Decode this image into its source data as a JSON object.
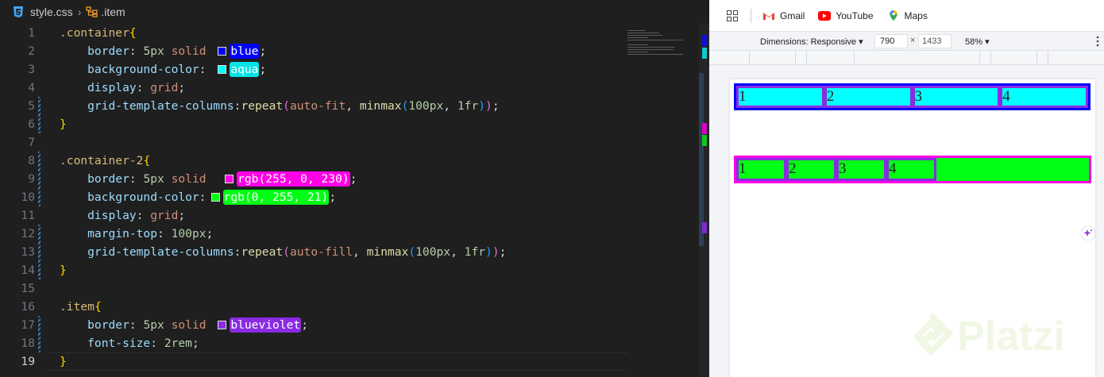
{
  "editor": {
    "breadcrumb": {
      "file": "style.css",
      "symbol": ".item"
    },
    "active_line": 19,
    "lines": [
      {
        "n": "1",
        "parts": [
          [
            "sel",
            ".container"
          ],
          [
            "br",
            "{"
          ]
        ]
      },
      {
        "n": "2",
        "parts": [
          [
            "prop",
            "    border"
          ],
          [
            "pn",
            ": "
          ],
          [
            "num",
            "5px"
          ],
          [
            "val",
            " solid "
          ],
          [
            "sw:#0000ff",
            ""
          ],
          [
            "hl:#0000ff",
            "blue"
          ],
          [
            "pn",
            ";"
          ]
        ]
      },
      {
        "n": "3",
        "parts": [
          [
            "prop",
            "    background-color"
          ],
          [
            "pn",
            ": "
          ],
          [
            "sw:#00ffff",
            ""
          ],
          [
            "hl:#00e5e5",
            "aqua"
          ],
          [
            "pn",
            ";"
          ]
        ]
      },
      {
        "n": "4",
        "parts": [
          [
            "prop",
            "    display"
          ],
          [
            "pn",
            ": "
          ],
          [
            "val",
            "grid"
          ],
          [
            "pn",
            ";"
          ]
        ]
      },
      {
        "n": "5",
        "parts": [
          [
            "prop",
            "    grid-template-columns"
          ],
          [
            "pn",
            ":"
          ],
          [
            "fn",
            "repeat"
          ],
          [
            "br2",
            "("
          ],
          [
            "val",
            "auto-fit"
          ],
          [
            "pn",
            ", "
          ],
          [
            "fn",
            "minmax"
          ],
          [
            "br3",
            "("
          ],
          [
            "num",
            "100px"
          ],
          [
            "pn",
            ", "
          ],
          [
            "num",
            "1fr"
          ],
          [
            "br3",
            ")"
          ],
          [
            "br2",
            ")"
          ],
          [
            "pn",
            ";"
          ]
        ]
      },
      {
        "n": "6",
        "parts": [
          [
            "br",
            "}"
          ]
        ]
      },
      {
        "n": "7",
        "parts": []
      },
      {
        "n": "8",
        "parts": [
          [
            "sel",
            ".container-2"
          ],
          [
            "br",
            "{"
          ]
        ]
      },
      {
        "n": "9",
        "parts": [
          [
            "prop",
            "    border"
          ],
          [
            "pn",
            ": "
          ],
          [
            "num",
            "5px"
          ],
          [
            "val",
            " solid  "
          ],
          [
            "sw:#ff00e6",
            ""
          ],
          [
            "hl:#ff00e6",
            "rgb(255, 0, 230)"
          ],
          [
            "pn",
            ";"
          ]
        ]
      },
      {
        "n": "10",
        "parts": [
          [
            "prop",
            "    background-color"
          ],
          [
            "pn",
            ":"
          ],
          [
            "sw:#00ff15",
            ""
          ],
          [
            "hl:#00ff15",
            "rgb(0, 255, 21)"
          ],
          [
            "pn",
            ";"
          ]
        ]
      },
      {
        "n": "11",
        "parts": [
          [
            "prop",
            "    display"
          ],
          [
            "pn",
            ": "
          ],
          [
            "val",
            "grid"
          ],
          [
            "pn",
            ";"
          ]
        ]
      },
      {
        "n": "12",
        "parts": [
          [
            "prop",
            "    margin-top"
          ],
          [
            "pn",
            ": "
          ],
          [
            "num",
            "100px"
          ],
          [
            "pn",
            ";"
          ]
        ]
      },
      {
        "n": "13",
        "parts": [
          [
            "prop",
            "    grid-template-columns"
          ],
          [
            "pn",
            ":"
          ],
          [
            "fn",
            "repeat"
          ],
          [
            "br2",
            "("
          ],
          [
            "val",
            "auto-fill"
          ],
          [
            "pn",
            ", "
          ],
          [
            "fn",
            "minmax"
          ],
          [
            "br3",
            "("
          ],
          [
            "num",
            "100px"
          ],
          [
            "pn",
            ", "
          ],
          [
            "num",
            "1fr"
          ],
          [
            "br3",
            ")"
          ],
          [
            "br2",
            ")"
          ],
          [
            "pn",
            ";"
          ]
        ]
      },
      {
        "n": "14",
        "parts": [
          [
            "br",
            "}"
          ]
        ]
      },
      {
        "n": "15",
        "parts": []
      },
      {
        "n": "16",
        "parts": [
          [
            "sel",
            ".item"
          ],
          [
            "br",
            "{"
          ]
        ]
      },
      {
        "n": "17",
        "parts": [
          [
            "prop",
            "    border"
          ],
          [
            "pn",
            ": "
          ],
          [
            "num",
            "5px"
          ],
          [
            "val",
            " solid "
          ],
          [
            "sw:#8a2be2",
            ""
          ],
          [
            "hl:#8a2be2",
            "blueviolet"
          ],
          [
            "pn",
            ";"
          ]
        ]
      },
      {
        "n": "18",
        "parts": [
          [
            "prop",
            "    font-size"
          ],
          [
            "pn",
            ": "
          ],
          [
            "num",
            "2rem"
          ],
          [
            "pn",
            ";"
          ]
        ]
      },
      {
        "n": "19",
        "parts": [
          [
            "br",
            "}"
          ]
        ]
      }
    ]
  },
  "browser": {
    "bookmarks": [
      {
        "label": "Gmail",
        "icon": "gmail-icon",
        "color": "#ea4335"
      },
      {
        "label": "YouTube",
        "icon": "youtube-icon",
        "color": "#ff0000"
      },
      {
        "label": "Maps",
        "icon": "maps-icon",
        "color": "#34a853"
      }
    ],
    "devtools": {
      "dimensions_label": "Dimensions: Responsive ▾",
      "width": "790",
      "x": "×",
      "height": "1433",
      "zoom": "58% ▾"
    },
    "page": {
      "container_items": [
        "1",
        "2",
        "3",
        "4"
      ],
      "container2_items": [
        "1",
        "2",
        "3",
        "4"
      ]
    }
  },
  "watermark": "Platzi"
}
